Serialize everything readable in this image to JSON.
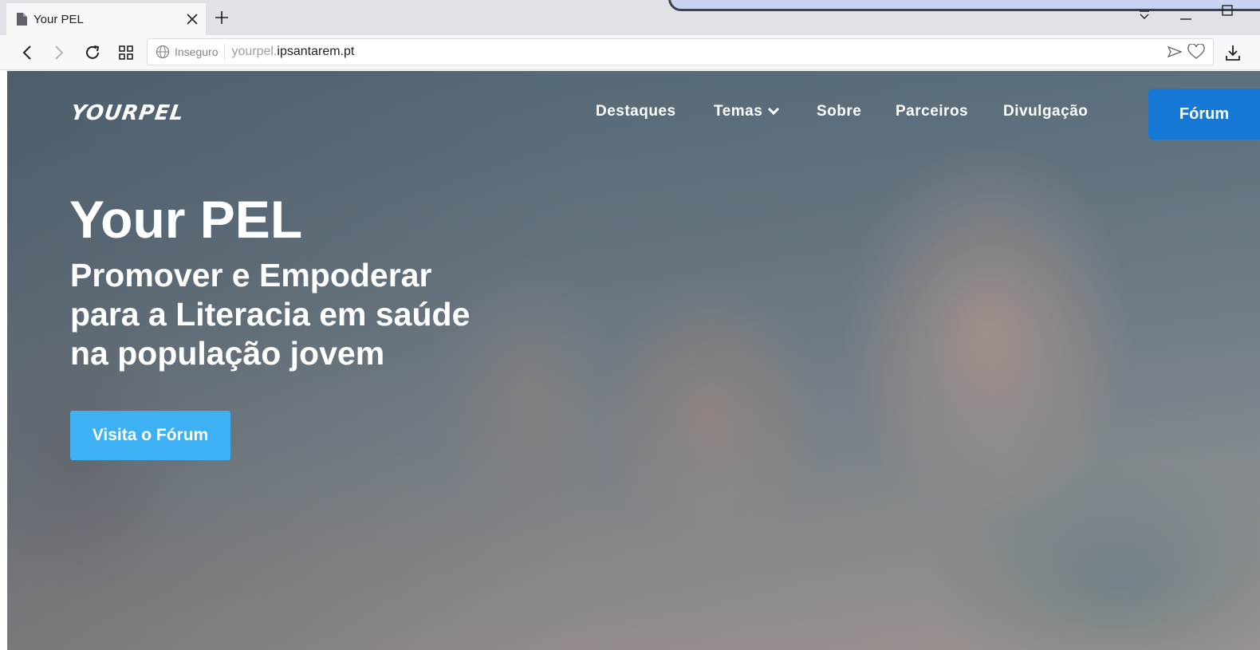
{
  "browser": {
    "tab_title": "Your PEL",
    "insecure_label": "Inseguro",
    "url_subdomain": "yourpel.",
    "url_domain": "ipsantarem.pt"
  },
  "site": {
    "logo": "YOURPEL",
    "nav": [
      {
        "label": "Destaques"
      },
      {
        "label": "Temas"
      },
      {
        "label": "Sobre"
      },
      {
        "label": "Parceiros"
      },
      {
        "label": "Divulgação"
      }
    ],
    "forum_button": "Fórum"
  },
  "hero": {
    "title": "Your PEL",
    "subtitle_lines": [
      "Promover e Empoderar",
      "para a Literacia em saúde",
      "na população jovem"
    ],
    "cta_label": "Visita o Fórum"
  },
  "colors": {
    "forum_button": "#1779d6",
    "cta_button": "#3eb1f5"
  }
}
